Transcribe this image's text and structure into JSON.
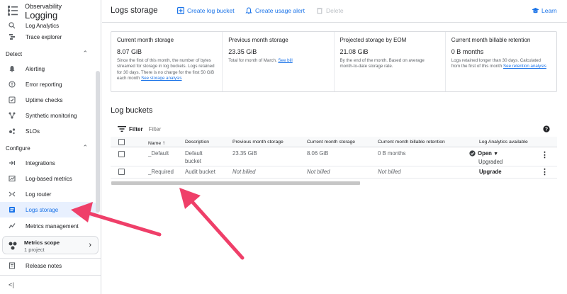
{
  "sidebar": {
    "product": "Observability",
    "title": "Logging",
    "items_top": [
      {
        "label": "Log Analytics",
        "icon": "log-analytics-icon"
      },
      {
        "label": "Trace explorer",
        "icon": "trace-icon"
      }
    ],
    "section_detect": "Detect",
    "items_detect": [
      {
        "label": "Alerting",
        "icon": "bell-icon"
      },
      {
        "label": "Error reporting",
        "icon": "error-reporting-icon"
      },
      {
        "label": "Uptime checks",
        "icon": "uptime-icon"
      },
      {
        "label": "Synthetic monitoring",
        "icon": "synthetic-icon"
      },
      {
        "label": "SLOs",
        "icon": "slo-icon"
      }
    ],
    "section_configure": "Configure",
    "items_configure": [
      {
        "label": "Integrations",
        "icon": "integrations-icon"
      },
      {
        "label": "Log-based metrics",
        "icon": "log-metrics-icon"
      },
      {
        "label": "Log router",
        "icon": "router-icon"
      },
      {
        "label": "Logs storage",
        "icon": "storage-icon",
        "active": true
      },
      {
        "label": "Metrics management",
        "icon": "metrics-mgmt-icon"
      }
    ],
    "metrics_scope": {
      "title": "Metrics scope",
      "subtitle": "1 project"
    },
    "release_notes": "Release notes",
    "collapse_icon": "collapse-icon"
  },
  "topbar": {
    "title": "Logs storage",
    "create_bucket": "Create log bucket",
    "create_alert": "Create usage alert",
    "delete": "Delete",
    "learn": "Learn"
  },
  "cards": [
    {
      "title": "Current month storage",
      "value": "8.07 GiB",
      "desc": "Since the first of this month, the number of bytes streamed for storage in log buckets. Logs retained for 30 days. There is no charge for the first 50 GiB each month",
      "link": "See storage analysis"
    },
    {
      "title": "Previous month storage",
      "value": "23.35 GiB",
      "desc": "Total for month of March.",
      "link": "See bill"
    },
    {
      "title": "Projected storage by EOM",
      "value": "21.08 GiB",
      "desc": "By the end of the month. Based on average month-to-date storage rate.",
      "link": ""
    },
    {
      "title": "Current month billable retention",
      "value": "0 B months",
      "desc": "Logs retained longer than 30 days. Calculated from the first of this month",
      "link": "See retention analysis"
    }
  ],
  "buckets": {
    "title": "Log buckets",
    "filter_label": "Filter",
    "filter_placeholder": "Filter",
    "columns": [
      "Name",
      "Description",
      "Previous month storage",
      "Current month storage",
      "Current month billable retention",
      "Log Analytics available"
    ],
    "rows": [
      {
        "name": "_Default",
        "desc_line1": "Default",
        "desc_line2": "bucket",
        "prev": "23.35 GiB",
        "curr": "8.06 GiB",
        "retention": "0 B months",
        "la_status": "Open",
        "la_sub": "Upgraded"
      },
      {
        "name": "_Required",
        "desc_line1": "Audit bucket",
        "prev": "Not billed",
        "curr": "Not billed",
        "retention": "Not billed",
        "la_status": "Upgrade"
      }
    ]
  },
  "colors": {
    "accent": "#1a73e8",
    "arrow": "#ef3f69"
  }
}
